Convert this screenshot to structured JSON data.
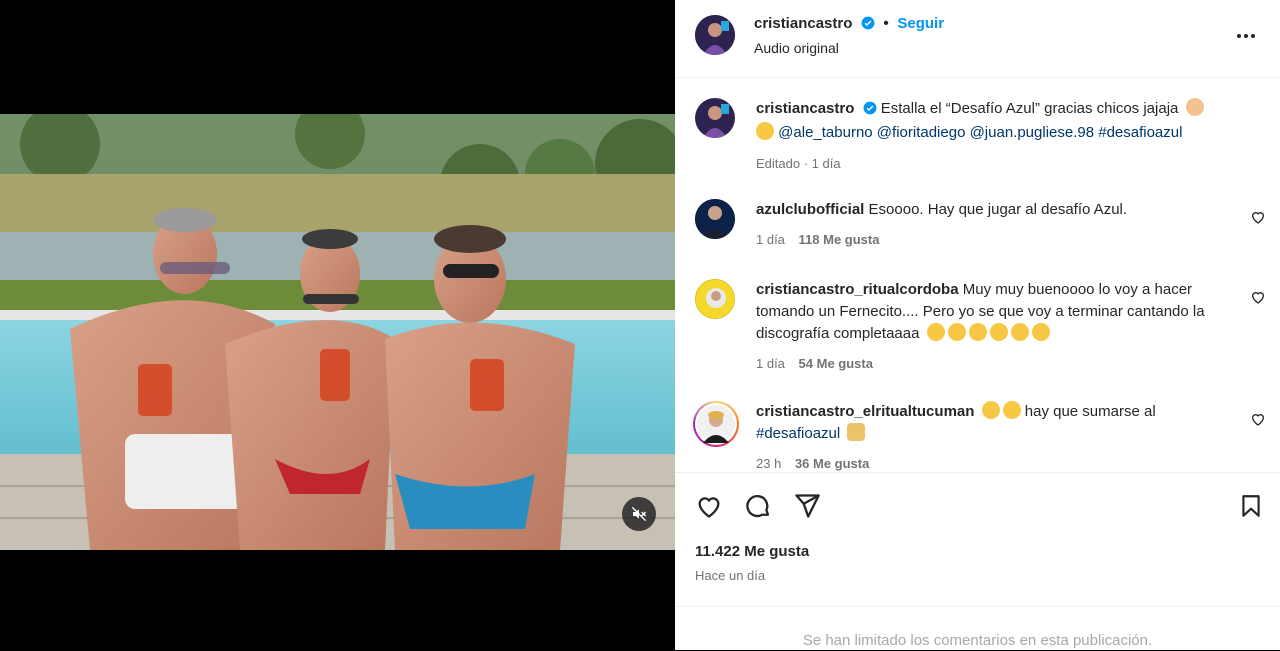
{
  "post": {
    "author": "cristiancastro",
    "follow_label": "Seguir",
    "separator": "•",
    "audio": "Audio original",
    "caption_text": "Estalla el “Desafío Azul” gracias chicos jajaja",
    "caption_mentions": "@ale_taburno @fioritadiego @juan.pugliese.98 #desafioazul",
    "caption_meta": "Editado · 1 día"
  },
  "comments": [
    {
      "user": "azulclubofficial",
      "text": "Esoooo. Hay que jugar al desafío Azul. ",
      "text_tail": "",
      "time": "1 día",
      "likes": "118 Me gusta"
    },
    {
      "user": "cristiancastro_ritualcordoba",
      "text": "Muy muy buenoooo lo voy a hacer tomando un Fernecito.... Pero yo se que voy a terminar cantando la discografía completaaaa",
      "text_tail": "",
      "time": "1 día",
      "likes": "54 Me gusta"
    },
    {
      "user": "cristiancastro_elritualtucuman",
      "text": "hay que sumarse al",
      "tag": "#desafioazul",
      "time": "23 h",
      "likes": "36 Me gusta"
    }
  ],
  "footer": {
    "likes": "11.422 Me gusta",
    "time": "Hace un día",
    "limited": "Se han limitado los comentarios en esta publicación."
  },
  "icons": {
    "heart": "heart-icon",
    "comment": "comment-icon",
    "share": "share-icon",
    "save": "bookmark-icon",
    "mute": "muted-speaker-icon",
    "more": "more-options-icon",
    "verified": "verified-badge-icon"
  },
  "colors": {
    "accent": "#0095f6",
    "verified": "#0095f6",
    "link": "#00376b",
    "muted_text": "#737373"
  }
}
